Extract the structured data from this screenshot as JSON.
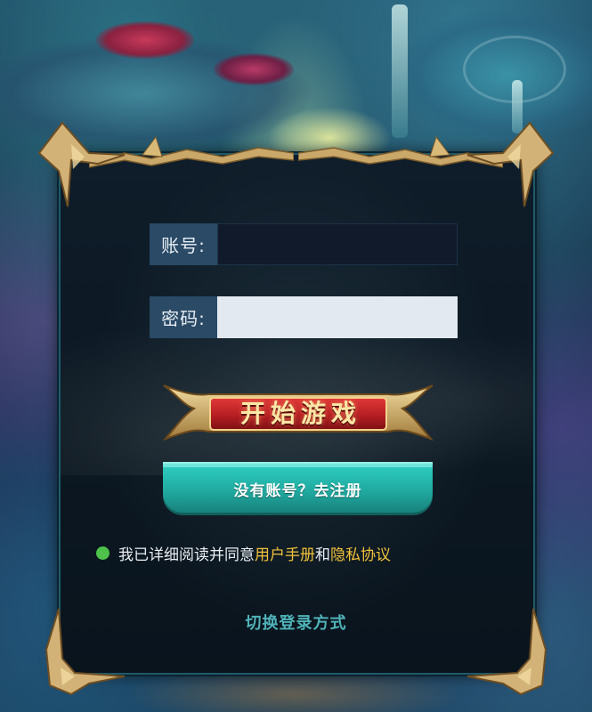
{
  "login_form": {
    "account_label": "账号:",
    "account_value": "",
    "password_label": "密码:",
    "password_value": ""
  },
  "start_button": {
    "label": "开始游戏"
  },
  "register_button": {
    "label": "没有账号？去注册"
  },
  "agreement": {
    "prefix": "我已详细阅读并同意",
    "user_manual_link": "用户手册",
    "conjunction": "和",
    "privacy_link": "隐私协议",
    "checked": true
  },
  "switch_login": {
    "label": "切换登录方式"
  },
  "colors": {
    "accent_gold": "#f2c23a",
    "register_teal": "#20a99f",
    "start_red": "#c4232a",
    "agree_green": "#4ec24a",
    "switch_teal": "#4fb3b8"
  }
}
